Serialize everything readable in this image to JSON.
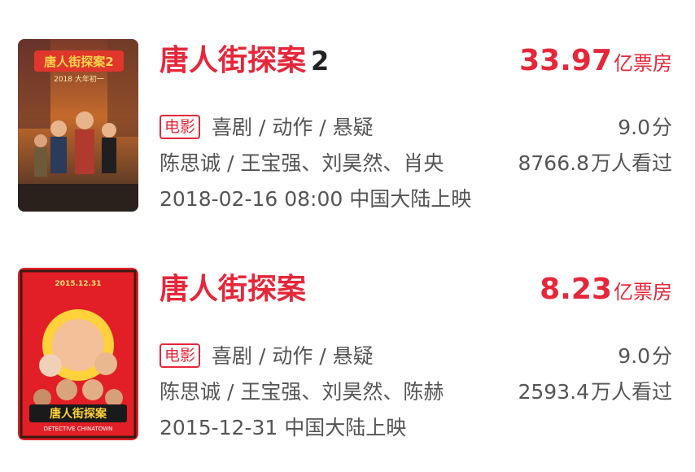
{
  "movies": [
    {
      "title": "唐人街探案",
      "title_suffix": "2",
      "box_office_value": "33.97",
      "box_office_unit": "亿票房",
      "tag": "电影",
      "genres": "喜剧 / 动作 / 悬疑",
      "rating": "9.0",
      "rating_unit": "分",
      "cast": "陈思诚 / 王宝强、刘昊然、肖央",
      "viewers": "8766.8",
      "viewers_unit": "万人看过",
      "release": "2018-02-16 08:00 中国大陆上映",
      "poster": {
        "title_text": "唐人街探案2",
        "sub_text": "2018 大年初一"
      }
    },
    {
      "title": "唐人街探案",
      "title_suffix": "",
      "box_office_value": "8.23",
      "box_office_unit": "亿票房",
      "tag": "电影",
      "genres": "喜剧 / 动作 / 悬疑",
      "rating": "9.0",
      "rating_unit": "分",
      "cast": "陈思诚 / 王宝强、刘昊然、陈赫",
      "viewers": "2593.4",
      "viewers_unit": "万人看过",
      "release": "2015-12-31 中国大陆上映",
      "poster": {
        "title_text": "唐人街探案",
        "sub_text": "2015.12.31",
        "bottom_text": "DETECTIVE CHINATOWN"
      }
    }
  ],
  "colors": {
    "accent": "#e6273a",
    "text": "#555555"
  }
}
